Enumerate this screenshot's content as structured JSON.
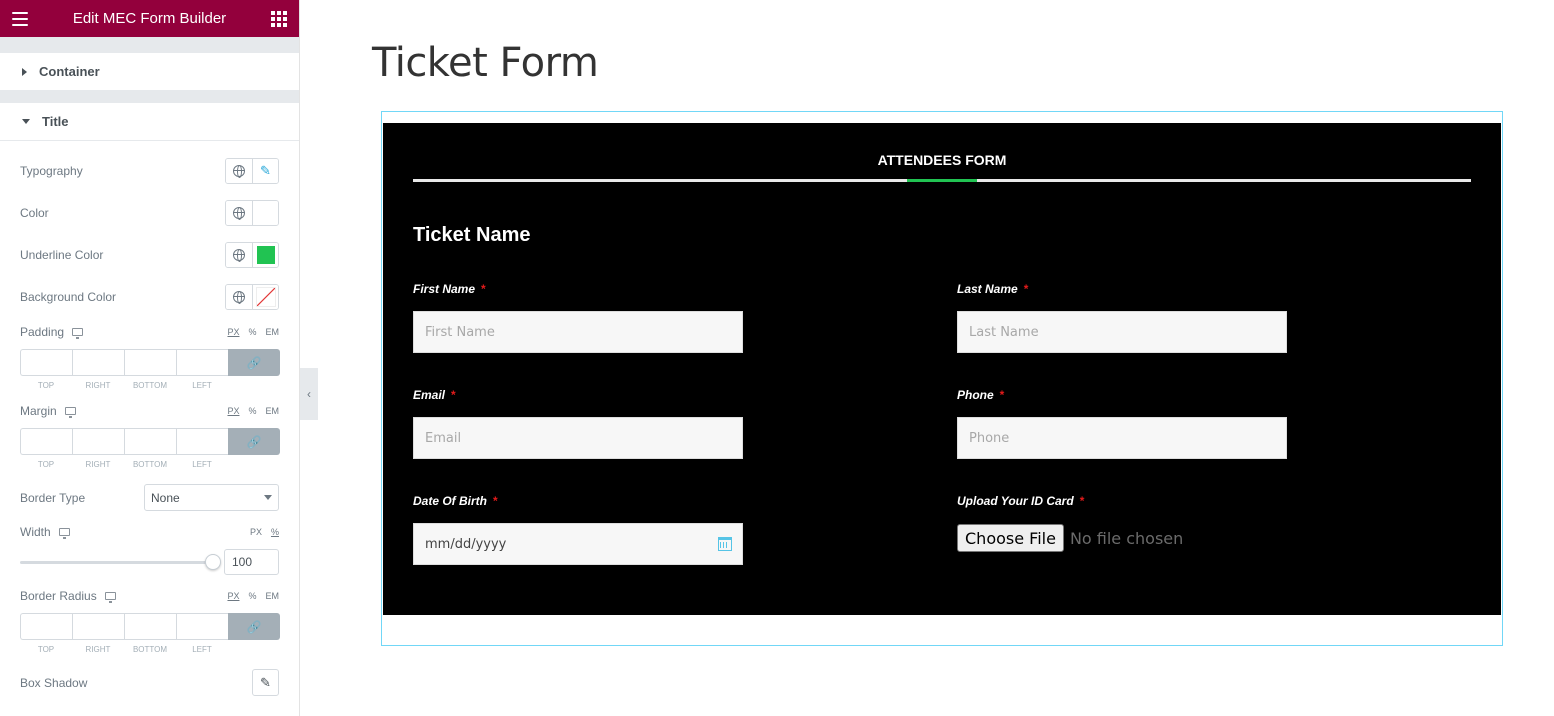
{
  "header": {
    "title": "Edit MEC Form Builder"
  },
  "sections": {
    "container": "Container",
    "title": "Title"
  },
  "controls": {
    "typography": "Typography",
    "color": "Color",
    "underline_color": "Underline Color",
    "underline_color_value": "#21c352",
    "background_color": "Background Color",
    "padding": "Padding",
    "margin": "Margin",
    "border_type": "Border Type",
    "border_type_value": "None",
    "width": "Width",
    "width_value": "100",
    "width_level_percent": 100,
    "border_radius": "Border Radius",
    "box_shadow": "Box Shadow",
    "units": {
      "px": "PX",
      "pct": "%",
      "em": "EM"
    },
    "dim_labels": {
      "top": "TOP",
      "right": "RIGHT",
      "bottom": "BOTTOM",
      "left": "LEFT"
    }
  },
  "main": {
    "page_title": "Ticket Form",
    "form_title": "ATTENDEES FORM",
    "ticket_name": "Ticket Name",
    "required_mark": "*",
    "fields": {
      "first_name": {
        "label": "First Name",
        "placeholder": "First Name"
      },
      "last_name": {
        "label": "Last Name",
        "placeholder": "Last Name"
      },
      "email": {
        "label": "Email",
        "placeholder": "Email"
      },
      "phone": {
        "label": "Phone",
        "placeholder": "Phone"
      },
      "dob": {
        "label": "Date Of Birth",
        "placeholder": "mm/dd/yyyy"
      },
      "id_card": {
        "label": "Upload Your ID Card",
        "button": "Choose File",
        "status": "No file chosen"
      }
    }
  },
  "colors": {
    "brand": "#93003c",
    "accent_green": "#21c352",
    "frame": "#71d7f7"
  }
}
